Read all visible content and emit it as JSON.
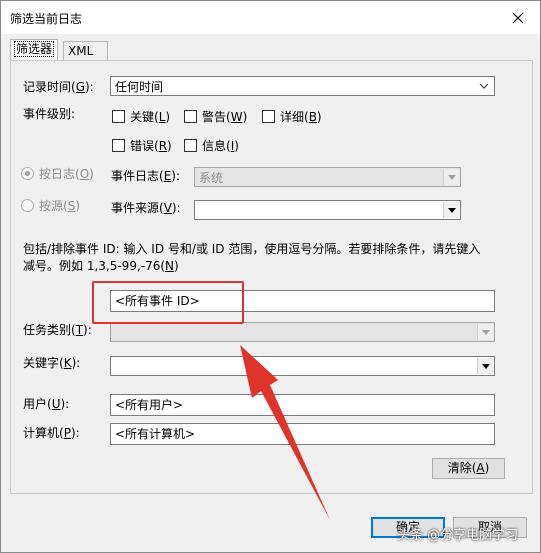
{
  "window": {
    "title": "筛选当前日志",
    "close_glyph": "✕"
  },
  "tabs": [
    {
      "label": "筛选器"
    },
    {
      "label": "XML"
    }
  ],
  "logged": {
    "label": "记录时间(",
    "key": "G",
    "suffix": "):",
    "value": "任何时间"
  },
  "level": {
    "label": "事件级别:",
    "critical": {
      "text": "关键(",
      "key": "L",
      "suffix": ")"
    },
    "warning": {
      "text": "警告(",
      "key": "W",
      "suffix": ")"
    },
    "verbose": {
      "text": "详细(",
      "key": "B",
      "suffix": ")"
    },
    "error": {
      "text": "错误(",
      "key": "R",
      "suffix": ")"
    },
    "info": {
      "text": "信息(",
      "key": "I",
      "suffix": ")"
    }
  },
  "by_log": {
    "text": "按日志(",
    "key": "O",
    "suffix": ")"
  },
  "by_source": {
    "text": "按源(",
    "key": "S",
    "suffix": ")"
  },
  "event_logs": {
    "label": "事件日志(",
    "key": "E",
    "suffix": "):",
    "value": "系统"
  },
  "event_sources": {
    "label": "事件来源(",
    "key": "V",
    "suffix": "):",
    "value": ""
  },
  "hint": {
    "line1": "包括/排除事件 ID: 输入 ID 号和/或 ID 范围，使用逗号分隔。若要排除条件，请先键入",
    "line2_pre": "减号。例如 1,3,5-99,-76(",
    "line2_key": "N",
    "line2_suf": ")"
  },
  "event_id": {
    "value": "<所有事件 ID>"
  },
  "task_category": {
    "label": "任务类别(",
    "key": "T",
    "suffix": "):",
    "value": ""
  },
  "keywords": {
    "label": "关键字(",
    "key": "K",
    "suffix": "):",
    "value": ""
  },
  "user": {
    "label": "用户(",
    "key": "U",
    "suffix": "):",
    "value": "<所有用户>"
  },
  "computer": {
    "label": "计算机(",
    "key": "P",
    "suffix": "):",
    "value": "<所有计算机>"
  },
  "clear": {
    "text": "清除(",
    "key": "A",
    "suffix": ")"
  },
  "ok": {
    "label": "确定"
  },
  "cancel": {
    "label": "取消"
  },
  "watermark": "头条 @分享电脑学习",
  "colors": {
    "annotation": "#e0332b",
    "focus": "#0078d7"
  }
}
